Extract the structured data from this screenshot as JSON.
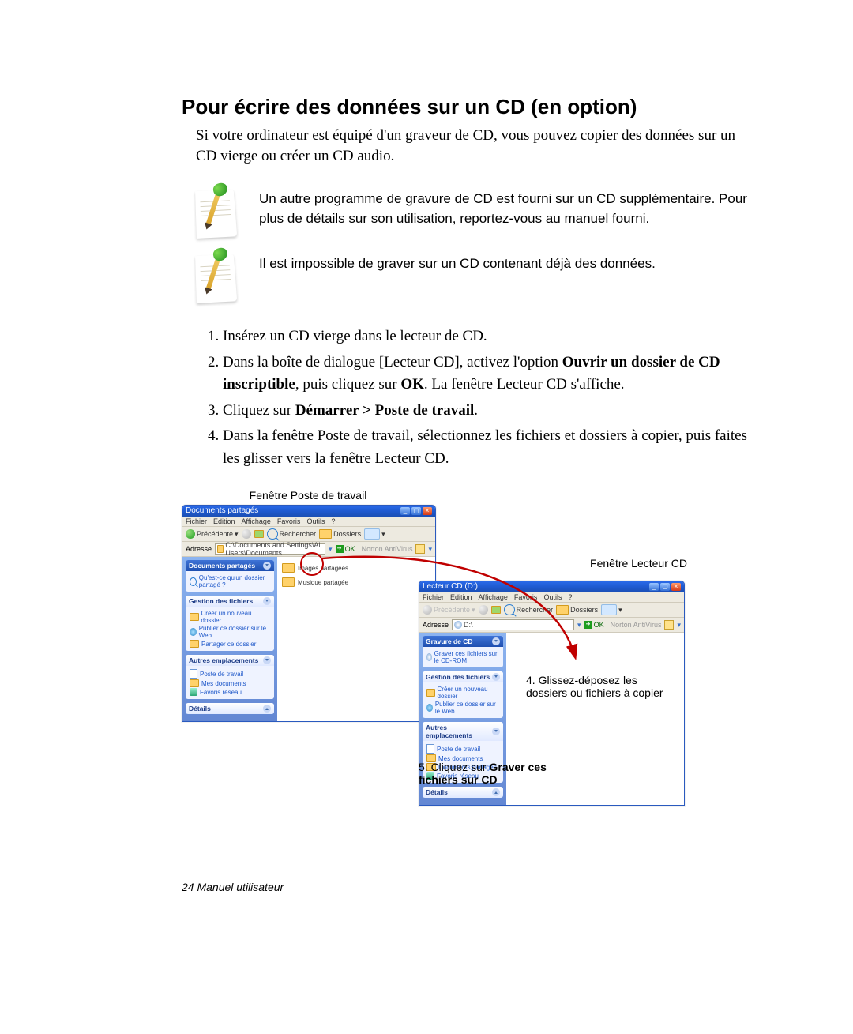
{
  "title": "Pour écrire des données sur un CD (en option)",
  "intro": "Si votre ordinateur est équipé d'un graveur de CD, vous pouvez copier des données sur un CD vierge ou créer un CD audio.",
  "note1": "Un autre programme de gravure de CD est fourni sur un CD supplémentaire. Pour plus de détails sur son utilisation, reportez-vous au manuel fourni.",
  "note2": "Il est impossible de graver sur un CD contenant déjà des données.",
  "steps": {
    "s1": "Insérez un CD vierge dans le lecteur de CD.",
    "s2_a": "Dans la boîte de dialogue [Lecteur CD], activez l'option ",
    "s2_b": "Ouvrir un dossier de CD inscriptible",
    "s2_c": ", puis cliquez sur ",
    "s2_d": "OK",
    "s2_e": ". La fenêtre Lecteur CD s'affiche.",
    "s3_a": "Cliquez sur ",
    "s3_b": "Démarrer > Poste de travail",
    "s3_c": ".",
    "s4": "Dans la fenêtre Poste de travail, sélectionnez les fichiers et dossiers à copier, puis faites les glisser vers la fenêtre Lecteur CD."
  },
  "caption_top": "Fenêtre Poste de travail",
  "caption_cd": "Fenêtre Lecteur CD",
  "drag_label_a": "4. Glissez-déposez les",
  "drag_label_b": "dossiers ou fichiers à copier",
  "step5_a": "5. Cliquez sur ",
  "step5_b": "Graver ces fichiers sur CD",
  "footer": "24  Manuel utilisateur",
  "win_menu": {
    "fichier": "Fichier",
    "edition": "Edition",
    "affichage": "Affichage",
    "favoris": "Favoris",
    "outils": "Outils",
    "aide": "?"
  },
  "win_shared": {
    "title": "Documents partagés",
    "back": "Précédente",
    "search": "Rechercher",
    "folders": "Dossiers",
    "addr_label": "Adresse",
    "addr_value": "C:\\Documents and Settings\\All Users\\Documents",
    "go": "OK",
    "norton": "Norton AntiVirus",
    "panel1_title": "Documents partagés",
    "panel1_q": "Qu'est-ce qu'un dossier partagé ?",
    "panel2_title": "Gestion des fichiers",
    "panel2_i1": "Créer un nouveau dossier",
    "panel2_i2": "Publier ce dossier sur le Web",
    "panel2_i3": "Partager ce dossier",
    "panel3_title": "Autres emplacements",
    "panel3_i1": "Poste de travail",
    "panel3_i2": "Mes documents",
    "panel3_i3": "Favoris réseau",
    "panel4_title": "Détails",
    "content_i1": "Images partagées",
    "content_i2": "Musique partagée"
  },
  "win_cd": {
    "title": "Lecteur CD (D:)",
    "back": "Précédente",
    "search": "Rechercher",
    "folders": "Dossiers",
    "addr_label": "Adresse",
    "addr_value": "D:\\",
    "go": "OK",
    "norton": "Norton AntiVirus",
    "panel1_title": "Gravure de CD",
    "panel1_i1": "Graver ces fichiers sur le CD-ROM",
    "panel2_title": "Gestion des fichiers",
    "panel2_i1": "Créer un nouveau dossier",
    "panel2_i2": "Publier ce dossier sur le Web",
    "panel3_title": "Autres emplacements",
    "panel3_i1": "Poste de travail",
    "panel3_i2": "Mes documents",
    "panel3_i3": "Documents partagés",
    "panel3_i4": "Favoris réseau",
    "panel4_title": "Détails"
  }
}
